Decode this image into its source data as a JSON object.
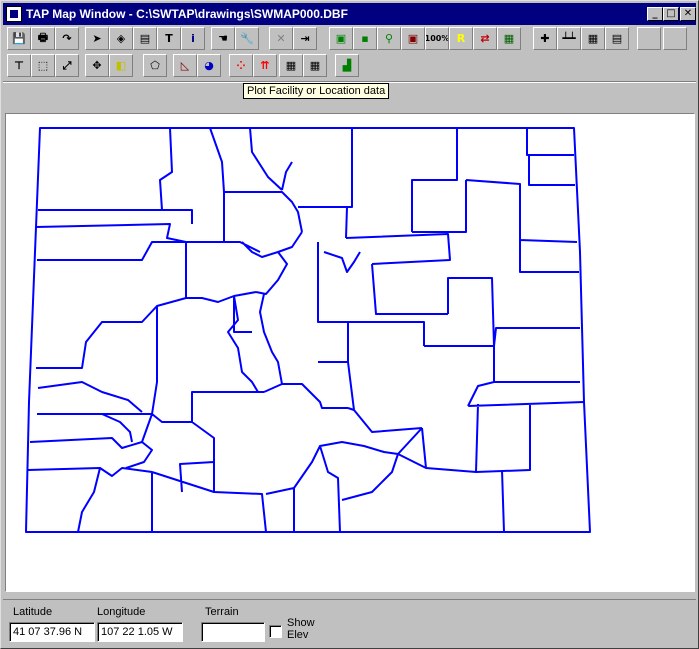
{
  "window": {
    "title": "TAP Map Window - C:\\SWTAP\\drawings\\SWMAP000.DBF",
    "controls": {
      "minimize": "_",
      "maximize": "□",
      "close": "✕"
    }
  },
  "toolbar1": [
    {
      "name": "save-button",
      "icon": "floppy-icon",
      "glyph": "💾"
    },
    {
      "name": "print-button",
      "icon": "printer-icon",
      "glyph": "🖶"
    },
    {
      "name": "redo-button",
      "icon": "arrow-curve-icon",
      "glyph": "↷"
    },
    {
      "name": "select-button",
      "icon": "pointer-icon",
      "glyph": "➤"
    },
    {
      "name": "fill-button",
      "icon": "paint-bucket-icon",
      "glyph": "◈"
    },
    {
      "name": "layer-button",
      "icon": "layers-icon",
      "glyph": "▤"
    },
    {
      "name": "text-button",
      "icon": "text-T-icon",
      "glyph": "T"
    },
    {
      "name": "info-button",
      "icon": "info-icon",
      "glyph": "i"
    },
    {
      "name": "hand-button",
      "icon": "hand-icon",
      "glyph": "☚"
    },
    {
      "name": "tool-button",
      "icon": "wrench-icon",
      "glyph": "🔧"
    },
    {
      "name": "delete-button",
      "icon": "x-icon",
      "glyph": "✕"
    },
    {
      "name": "exit-button",
      "icon": "door-arrow-icon",
      "glyph": "⇥"
    },
    {
      "name": "zoom-all-button",
      "icon": "green-box-icon",
      "glyph": "▣"
    },
    {
      "name": "zoom-small-button",
      "icon": "green-dot-icon",
      "glyph": "▪"
    },
    {
      "name": "zoom-in-button",
      "icon": "magnifier-icon",
      "glyph": "⚲"
    },
    {
      "name": "zoom-out-button",
      "icon": "red-box-icon",
      "glyph": "▣"
    },
    {
      "name": "zoom-100-button",
      "icon": "percent-icon",
      "glyph": "100%"
    },
    {
      "name": "r-button",
      "icon": "r-letter-icon",
      "glyph": "R"
    },
    {
      "name": "export-button",
      "icon": "export-icon",
      "glyph": "⇄"
    },
    {
      "name": "map-button",
      "icon": "map-icon",
      "glyph": "▦"
    },
    {
      "name": "add-button",
      "icon": "plus-icon",
      "glyph": "✚"
    },
    {
      "name": "ruler-button",
      "icon": "ruler-icon",
      "glyph": "┷┷"
    },
    {
      "name": "grid-button",
      "icon": "grid-icon",
      "glyph": "▦"
    },
    {
      "name": "notes-button",
      "icon": "notepad-icon",
      "glyph": "▤"
    },
    {
      "name": "blank-button-1",
      "icon": "blank-icon",
      "glyph": ""
    },
    {
      "name": "blank-button-2",
      "icon": "blank-icon",
      "glyph": ""
    }
  ],
  "toolbar2": [
    {
      "name": "line-button",
      "icon": "line-tool-icon",
      "glyph": "⊤"
    },
    {
      "name": "rect-select-button",
      "icon": "rect-select-icon",
      "glyph": "⬚"
    },
    {
      "name": "resize-button",
      "icon": "diagonal-arrow-icon",
      "glyph": "⤢"
    },
    {
      "name": "pan-button",
      "icon": "move-cross-icon",
      "glyph": "✥"
    },
    {
      "name": "overlay-button",
      "icon": "overlap-squares-icon",
      "glyph": "◧"
    },
    {
      "name": "polygon-button",
      "icon": "polygon-icon",
      "glyph": "⬠"
    },
    {
      "name": "shade-button",
      "icon": "shade-icon",
      "glyph": "◺"
    },
    {
      "name": "pie-button",
      "icon": "pie-chart-icon",
      "glyph": "◕"
    },
    {
      "name": "plot-facility-button",
      "icon": "scatter-points-icon",
      "glyph": "⁘"
    },
    {
      "name": "vector-button",
      "icon": "red-arrows-icon",
      "glyph": "⇈"
    },
    {
      "name": "grid-plot-button",
      "icon": "grid-icon",
      "glyph": "▦"
    },
    {
      "name": "contour-button",
      "icon": "color-grid-icon",
      "glyph": "▦"
    },
    {
      "name": "histogram-button",
      "icon": "bar-chart-icon",
      "glyph": "▟"
    }
  ],
  "tooltip": "Plot Facility or Location data",
  "status": {
    "latitude_label": "Latitude",
    "latitude_value": "41 07 37.96 N",
    "longitude_label": "Longitude",
    "longitude_value": "107 22 1.05 W",
    "terrain_label": "Terrain",
    "terrain_value": "",
    "show_elev_label_1": "Show",
    "show_elev_label_2": "Elev",
    "show_elev_checked": false
  },
  "colors": {
    "title_bg": "#000080",
    "map_lines": "#0000ff",
    "tooltip_bg": "#ffffe1"
  }
}
